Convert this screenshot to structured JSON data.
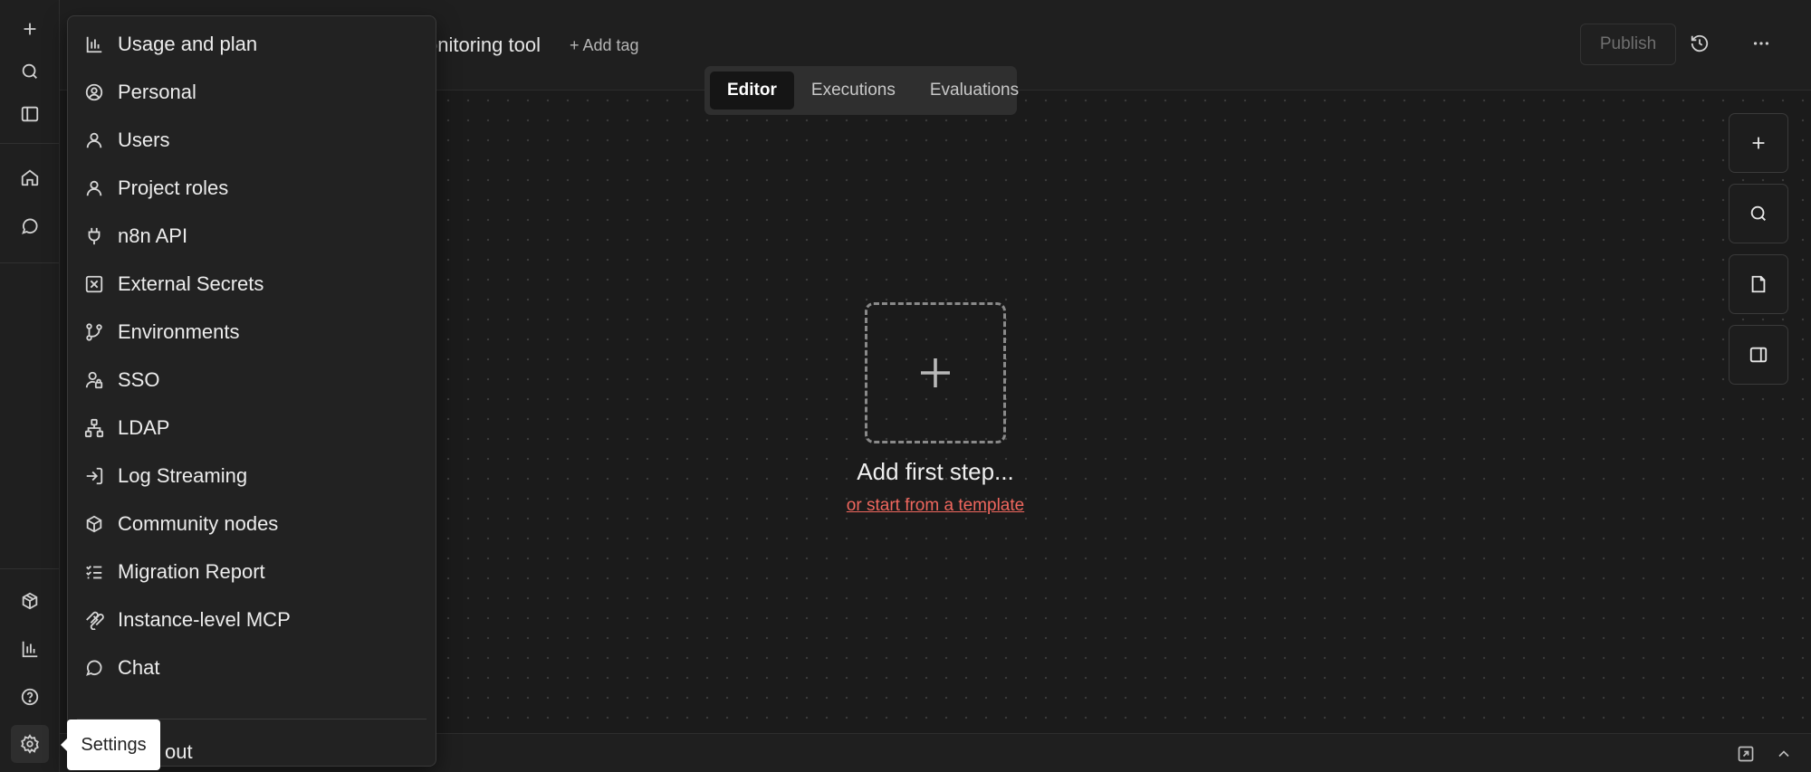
{
  "header": {
    "workflow_name": "onitoring tool",
    "add_tag_label": "+ Add tag",
    "publish_label": "Publish",
    "history_icon": "history-icon",
    "more_icon": "more-horizontal-icon"
  },
  "tabs": [
    {
      "label": "Editor",
      "active": true
    },
    {
      "label": "Executions",
      "active": false
    },
    {
      "label": "Evaluations",
      "active": false
    }
  ],
  "rail": {
    "top_icons": [
      "plus-icon",
      "search-icon",
      "sidebar-toggle-icon"
    ],
    "nav_icons": [
      "home-icon",
      "chat-bubble-icon"
    ],
    "bottom_icons": [
      "templates-icon",
      "insights-icon",
      "help-icon",
      "settings-icon"
    ]
  },
  "settings_menu": {
    "items": [
      {
        "label": "Usage and plan",
        "icon": "bar-chart-icon"
      },
      {
        "label": "Personal",
        "icon": "user-circle-icon"
      },
      {
        "label": "Users",
        "icon": "user-icon"
      },
      {
        "label": "Project roles",
        "icon": "user-icon"
      },
      {
        "label": "n8n API",
        "icon": "plug-icon"
      },
      {
        "label": "External Secrets",
        "icon": "secret-box-icon"
      },
      {
        "label": "Environments",
        "icon": "git-branch-icon"
      },
      {
        "label": "SSO",
        "icon": "user-lock-icon"
      },
      {
        "label": "LDAP",
        "icon": "network-icon"
      },
      {
        "label": "Log Streaming",
        "icon": "log-in-icon"
      },
      {
        "label": "Community nodes",
        "icon": "box-icon"
      },
      {
        "label": "Migration Report",
        "icon": "checklist-icon"
      },
      {
        "label": "Instance-level MCP",
        "icon": "mcp-icon"
      },
      {
        "label": "Chat",
        "icon": "chat-bubble-icon"
      }
    ],
    "signout_label": "out"
  },
  "tooltip": {
    "label": "Settings"
  },
  "canvas": {
    "add_first_step_label": "Add first step...",
    "template_link_label": "or start from a template",
    "tools": [
      "zoom-in-icon",
      "search-icon",
      "sticky-note-icon",
      "panel-toggle-icon"
    ]
  },
  "colors": {
    "background": "#1b1b1b",
    "link_accent": "#f0675e",
    "menu_background": "#222222"
  }
}
